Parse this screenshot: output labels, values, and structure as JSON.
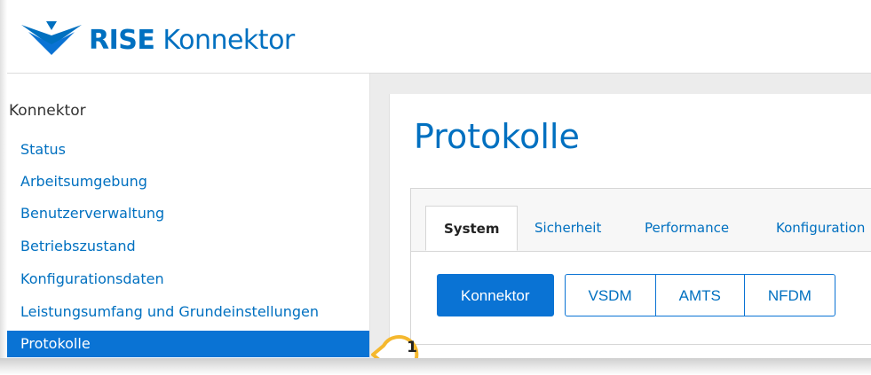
{
  "app": {
    "brand_bold": "RISE",
    "brand_rest": " Konnektor"
  },
  "sidebar": {
    "title": "Konnektor",
    "items": [
      {
        "label": "Status"
      },
      {
        "label": "Arbeitsumgebung"
      },
      {
        "label": "Benutzerverwaltung"
      },
      {
        "label": "Betriebszustand"
      },
      {
        "label": "Konfigurationsdaten"
      },
      {
        "label": "Leistungsumfang und Grundeinstellungen"
      },
      {
        "label": "Protokolle",
        "active": true
      }
    ]
  },
  "main": {
    "title": "Protokolle",
    "tabs": [
      {
        "label": "System",
        "active": true
      },
      {
        "label": "Sicherheit"
      },
      {
        "label": "Performance"
      },
      {
        "label": "Konfiguration"
      }
    ],
    "buttons": [
      {
        "label": "Konnektor",
        "active": true
      },
      {
        "label": "VSDM"
      },
      {
        "label": "AMTS"
      },
      {
        "label": "NFDM"
      }
    ]
  },
  "callout": {
    "number": "1",
    "color": "#f5b82e"
  },
  "colors": {
    "accent": "#0a73d4",
    "link": "#0070c0"
  },
  "icons": {
    "logo": "rise-logo-icon"
  }
}
